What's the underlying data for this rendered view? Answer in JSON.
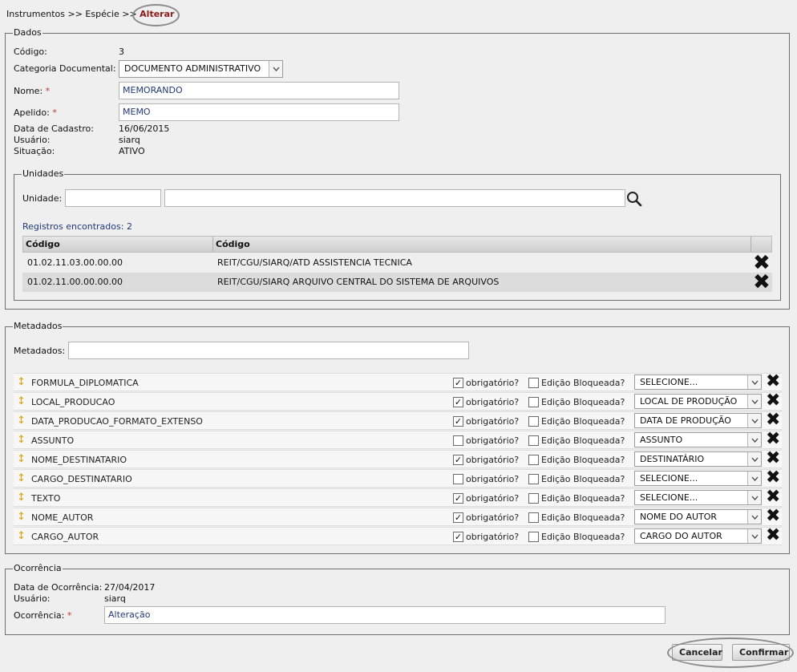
{
  "breadcrumb": {
    "items": [
      "Instrumentos",
      "Espécie"
    ],
    "separator": ">>",
    "current": "Alterar"
  },
  "dados": {
    "legend": "Dados",
    "codigo_label": "Código:",
    "codigo_value": "3",
    "categoria_label": "Categoria Documental:",
    "categoria_value": "DOCUMENTO ADMINISTRATIVO",
    "nome_label": "Nome:",
    "nome_value": "MEMORANDO",
    "apelido_label": "Apelido:",
    "apelido_value": "MEMO",
    "required_mark": "*",
    "data_cadastro_label": "Data de Cadastro:",
    "data_cadastro_value": "16/06/2015",
    "usuario_label": "Usuário:",
    "usuario_value": "siarq",
    "situacao_label": "Situação:",
    "situacao_value": "ATIVO"
  },
  "unidades": {
    "legend": "Unidades",
    "unidade_label": "Unidade:",
    "codigo_input_value": "",
    "nome_input_value": "",
    "registros_text": "Registros encontrados: 2",
    "columns": [
      "Código",
      "Código"
    ],
    "rows": [
      {
        "codigo": "01.02.11.03.00.00.00",
        "nome": "REIT/CGU/SIARQ/ATD ASSISTENCIA TECNICA"
      },
      {
        "codigo": "01.02.11.00.00.00.00",
        "nome": "REIT/CGU/SIARQ ARQUIVO CENTRAL DO SISTEMA DE ARQUIVOS"
      }
    ]
  },
  "metadados": {
    "legend": "Metadados",
    "input_label": "Metadados:",
    "input_value": "",
    "obrigatorio_label": "obrigatório?",
    "edicao_label": "Edição Bloqueada?",
    "rows": [
      {
        "name": "FORMULA_DIPLOMATICA",
        "obrigatorio": true,
        "bloqueada": false,
        "select": "SELECIONE..."
      },
      {
        "name": "LOCAL_PRODUCAO",
        "obrigatorio": true,
        "bloqueada": false,
        "select": "LOCAL DE PRODUÇÃO"
      },
      {
        "name": "DATA_PRODUCAO_FORMATO_EXTENSO",
        "obrigatorio": true,
        "bloqueada": false,
        "select": "DATA DE PRODUÇÃO"
      },
      {
        "name": "ASSUNTO",
        "obrigatorio": false,
        "bloqueada": false,
        "select": "ASSUNTO"
      },
      {
        "name": "NOME_DESTINATARIO",
        "obrigatorio": true,
        "bloqueada": false,
        "select": "DESTINATÁRIO"
      },
      {
        "name": "CARGO_DESTINATARIO",
        "obrigatorio": false,
        "bloqueada": false,
        "select": "SELECIONE..."
      },
      {
        "name": "TEXTO",
        "obrigatorio": true,
        "bloqueada": false,
        "select": "SELECIONE..."
      },
      {
        "name": "NOME_AUTOR",
        "obrigatorio": true,
        "bloqueada": false,
        "select": "NOME DO AUTOR"
      },
      {
        "name": "CARGO_AUTOR",
        "obrigatorio": true,
        "bloqueada": false,
        "select": "CARGO DO AUTOR"
      }
    ]
  },
  "ocorrencia": {
    "legend": "Ocorrência",
    "data_label": "Data de Ocorrência:",
    "data_value": "27/04/2017",
    "usuario_label": "Usuário:",
    "usuario_value": "siarq",
    "ocorrencia_label": "Ocorrência:",
    "ocorrencia_value": "Alteração",
    "required_mark": "*"
  },
  "actions": {
    "cancelar_label": "Cancelar",
    "confirmar_label": "Confirmar"
  },
  "icons": {
    "search": "search-icon",
    "remove": "close-icon",
    "drag": "drag-handle-icon",
    "dropdown": "chevron-down-icon",
    "check": "✓"
  },
  "colors": {
    "background": "#efefef",
    "breadcrumb_current": "#8b1a1a",
    "required": "#c0392b",
    "link_blue": "#22397a",
    "drag_handle": "#e0a400"
  }
}
